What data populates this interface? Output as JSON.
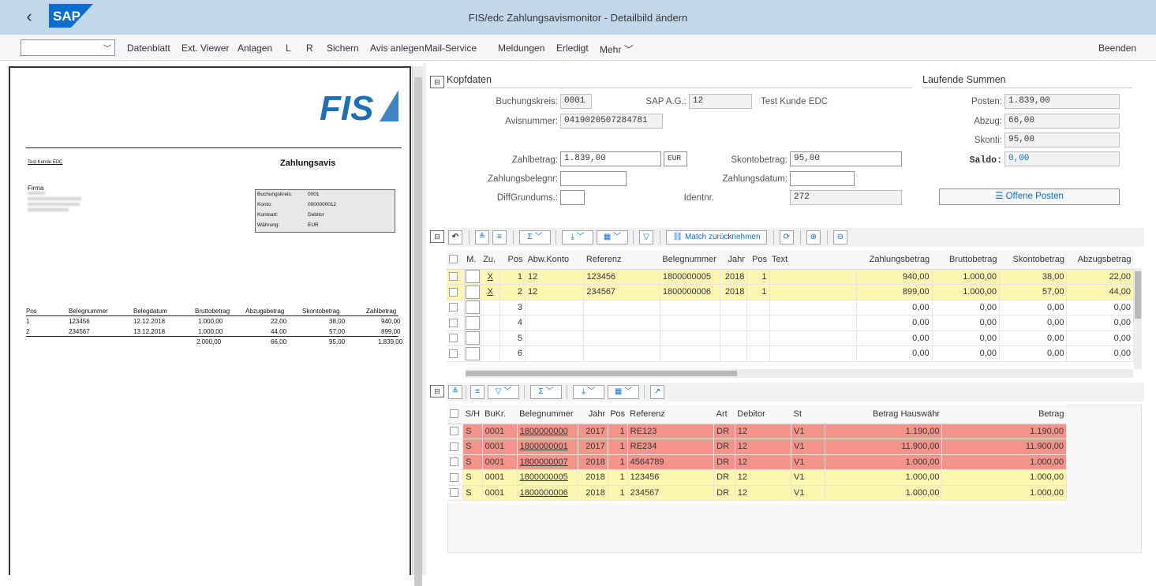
{
  "window": {
    "title": "FIS/edc Zahlungsavismonitor - Detailbild ändern",
    "logo_text": "SAP"
  },
  "toolbar": {
    "dropdown_value": "",
    "items": [
      "Datenblatt",
      "Ext. Viewer",
      "Anlagen",
      "L",
      "R",
      "Sichern",
      "Avis anlegen",
      "Mail-Service",
      "Meldungen",
      "Erledigt",
      "Mehr"
    ],
    "exit": "Beenden"
  },
  "document": {
    "logo": "FIS",
    "sender": "Test Kunde EDC",
    "title": "Zahlungsavis",
    "firma": "Firma",
    "info": [
      {
        "k": "Buchungskreis:",
        "v": "0001"
      },
      {
        "k": "Konto:",
        "v": "0000000012"
      },
      {
        "k": "Kontoart:",
        "v": "Debitor"
      },
      {
        "k": "Währung:",
        "v": "EUR"
      }
    ],
    "columns": [
      "Pos",
      "Belegnummer",
      "Belegdatum",
      "Bruttobetrag",
      "Abzugsbetrag",
      "Skontobetrag",
      "Zahlbetrag"
    ],
    "rows": [
      [
        "1",
        "123456",
        "12.12.2018",
        "1.000,00",
        "22,00",
        "38,00",
        "940,00"
      ],
      [
        "2",
        "234567",
        "13.12.2018",
        "1.000,00",
        "44,00",
        "57,00",
        "899,00"
      ]
    ],
    "totals": [
      "2.000,00",
      "66,00",
      "95,00",
      "1.839,00"
    ]
  },
  "kopf": {
    "title": "Kopfdaten",
    "buchungskreis_label": "Buchungskreis:",
    "buchungskreis": "0001",
    "sapag_label": "SAP A.G.:",
    "sapag": "12",
    "kunde": "Test Kunde EDC",
    "avisnummer_label": "Avisnummer:",
    "avisnummer": "0419020507284781",
    "zahlbetrag_label": "Zahlbetrag:",
    "zahlbetrag": "1.839,00",
    "waehrung": "EUR",
    "skontobetrag_label": "Skontobetrag:",
    "skontobetrag": "95,00",
    "zahlungsbelegnr_label": "Zahlungsbelegnr:",
    "zahlungsbelegnr": "",
    "zahlungsdatum_label": "Zahlungsdatum:",
    "zahlungsdatum": "",
    "diffgrund_label": "DiffGrundums.:",
    "diffgrund": "",
    "identnr_label": "Identnr.",
    "identnr": "272"
  },
  "summen": {
    "title": "Laufende Summen",
    "posten_label": "Posten:",
    "posten": "1.839,00",
    "abzug_label": "Abzug:",
    "abzug": "66,00",
    "skonti_label": "Skonti:",
    "skonti": "95,00",
    "saldo_label": "Saldo:",
    "saldo": "0,00",
    "offene_posten": "Offene Posten"
  },
  "grid1": {
    "toolbar_match": "Match zurücknehmen",
    "columns": [
      "M.",
      "Zu.",
      "Pos",
      "Abw.Konto",
      "Referenz",
      "Belegnummer",
      "Jahr",
      "Pos",
      "Text",
      "Zahlungsbetrag",
      "Bruttobetrag",
      "Skontobetrag",
      "Abzugsbetrag"
    ],
    "rows": [
      {
        "zu": "X",
        "pos": "1",
        "konto": "12",
        "ref": "123456",
        "beleg": "1800000005",
        "jahr": "2018",
        "pos2": "1",
        "zb": "940,00",
        "bb": "1.000,00",
        "sb": "38,00",
        "ab": "22,00"
      },
      {
        "zu": "X",
        "pos": "2",
        "konto": "12",
        "ref": "234567",
        "beleg": "1800000006",
        "jahr": "2018",
        "pos2": "1",
        "zb": "899,00",
        "bb": "1.000,00",
        "sb": "57,00",
        "ab": "44,00"
      },
      {
        "zu": "",
        "pos": "3",
        "konto": "",
        "ref": "",
        "beleg": "",
        "jahr": "",
        "pos2": "",
        "zb": "0,00",
        "bb": "0,00",
        "sb": "0,00",
        "ab": "0,00"
      },
      {
        "zu": "",
        "pos": "4",
        "konto": "",
        "ref": "",
        "beleg": "",
        "jahr": "",
        "pos2": "",
        "zb": "0,00",
        "bb": "0,00",
        "sb": "0,00",
        "ab": "0,00"
      },
      {
        "zu": "",
        "pos": "5",
        "konto": "",
        "ref": "",
        "beleg": "",
        "jahr": "",
        "pos2": "",
        "zb": "0,00",
        "bb": "0,00",
        "sb": "0,00",
        "ab": "0,00"
      },
      {
        "zu": "",
        "pos": "6",
        "konto": "",
        "ref": "",
        "beleg": "",
        "jahr": "",
        "pos2": "",
        "zb": "0,00",
        "bb": "0,00",
        "sb": "0,00",
        "ab": "0,00"
      }
    ]
  },
  "grid2": {
    "columns": [
      "S/H",
      "BuKr.",
      "Belegnummer",
      "Jahr",
      "Pos",
      "Referenz",
      "Art",
      "Debitor",
      "St",
      "Betrag Hauswähr",
      "Betrag"
    ],
    "rows": [
      {
        "sh": "S",
        "bukr": "0001",
        "beleg": "1800000000",
        "jahr": "2017",
        "pos": "1",
        "ref": "RE123",
        "art": "DR",
        "deb": "12",
        "st": "V1",
        "bh": "1.190,00",
        "b": "1.190,00",
        "color": "red"
      },
      {
        "sh": "S",
        "bukr": "0001",
        "beleg": "1800000001",
        "jahr": "2017",
        "pos": "1",
        "ref": "RE234",
        "art": "DR",
        "deb": "12",
        "st": "V1",
        "bh": "11.900,00",
        "b": "11.900,00",
        "color": "red"
      },
      {
        "sh": "S",
        "bukr": "0001",
        "beleg": "1800000007",
        "jahr": "2018",
        "pos": "1",
        "ref": "4564789",
        "art": "DR",
        "deb": "12",
        "st": "V1",
        "bh": "1.000,00",
        "b": "1.000,00",
        "color": "red"
      },
      {
        "sh": "S",
        "bukr": "0001",
        "beleg": "1800000005",
        "jahr": "2018",
        "pos": "1",
        "ref": "123456",
        "art": "DR",
        "deb": "12",
        "st": "V1",
        "bh": "1.000,00",
        "b": "1.000,00",
        "color": "ylw"
      },
      {
        "sh": "S",
        "bukr": "0001",
        "beleg": "1800000006",
        "jahr": "2018",
        "pos": "1",
        "ref": "234567",
        "art": "DR",
        "deb": "12",
        "st": "V1",
        "bh": "1.000,00",
        "b": "1.000,00",
        "color": "ylw"
      }
    ]
  }
}
